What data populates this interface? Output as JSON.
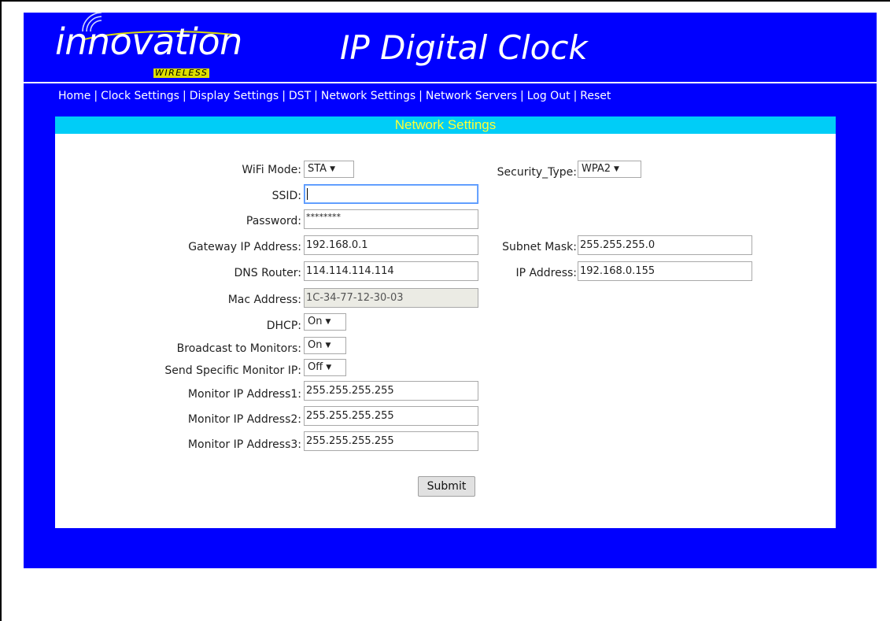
{
  "header": {
    "logo_text": "innovation",
    "logo_subtext": "WIRELESS",
    "title": "IP Digital Clock"
  },
  "nav": {
    "items": [
      "Home",
      "Clock Settings",
      "Display Settings",
      "DST",
      "Network Settings",
      "Network Servers",
      "Log Out",
      "Reset"
    ],
    "separator": "|"
  },
  "panel": {
    "title": "Network Settings"
  },
  "form": {
    "wifi_mode": {
      "label": "WiFi Mode:",
      "value": "STA"
    },
    "security_type": {
      "label": "Security_Type:",
      "value": "WPA2"
    },
    "ssid": {
      "label": "SSID:",
      "value": ""
    },
    "password": {
      "label": "Password:",
      "value": "********"
    },
    "gateway_ip": {
      "label": "Gateway IP Address:",
      "value": "192.168.0.1"
    },
    "subnet_mask": {
      "label": "Subnet Mask:",
      "value": "255.255.255.0"
    },
    "dns_router": {
      "label": "DNS Router:",
      "value": "114.114.114.114"
    },
    "ip_address": {
      "label": "IP Address:",
      "value": "192.168.0.155"
    },
    "mac_address": {
      "label": "Mac Address:",
      "value": "1C-34-77-12-30-03"
    },
    "dhcp": {
      "label": "DHCP:",
      "value": "On"
    },
    "broadcast_monitors": {
      "label": "Broadcast to Monitors:",
      "value": "On"
    },
    "send_specific_monitor_ip": {
      "label": "Send Specific Monitor IP:",
      "value": "Off"
    },
    "monitor_ip_1": {
      "label": "Monitor IP Address1:",
      "value": "255.255.255.255"
    },
    "monitor_ip_2": {
      "label": "Monitor IP Address2:",
      "value": "255.255.255.255"
    },
    "monitor_ip_3": {
      "label": "Monitor IP Address3:",
      "value": "255.255.255.255"
    },
    "submit_label": "Submit"
  },
  "colors": {
    "page_background": "#0000ff",
    "panel_header": "#00cdf7",
    "panel_header_text": "#ffff33"
  }
}
